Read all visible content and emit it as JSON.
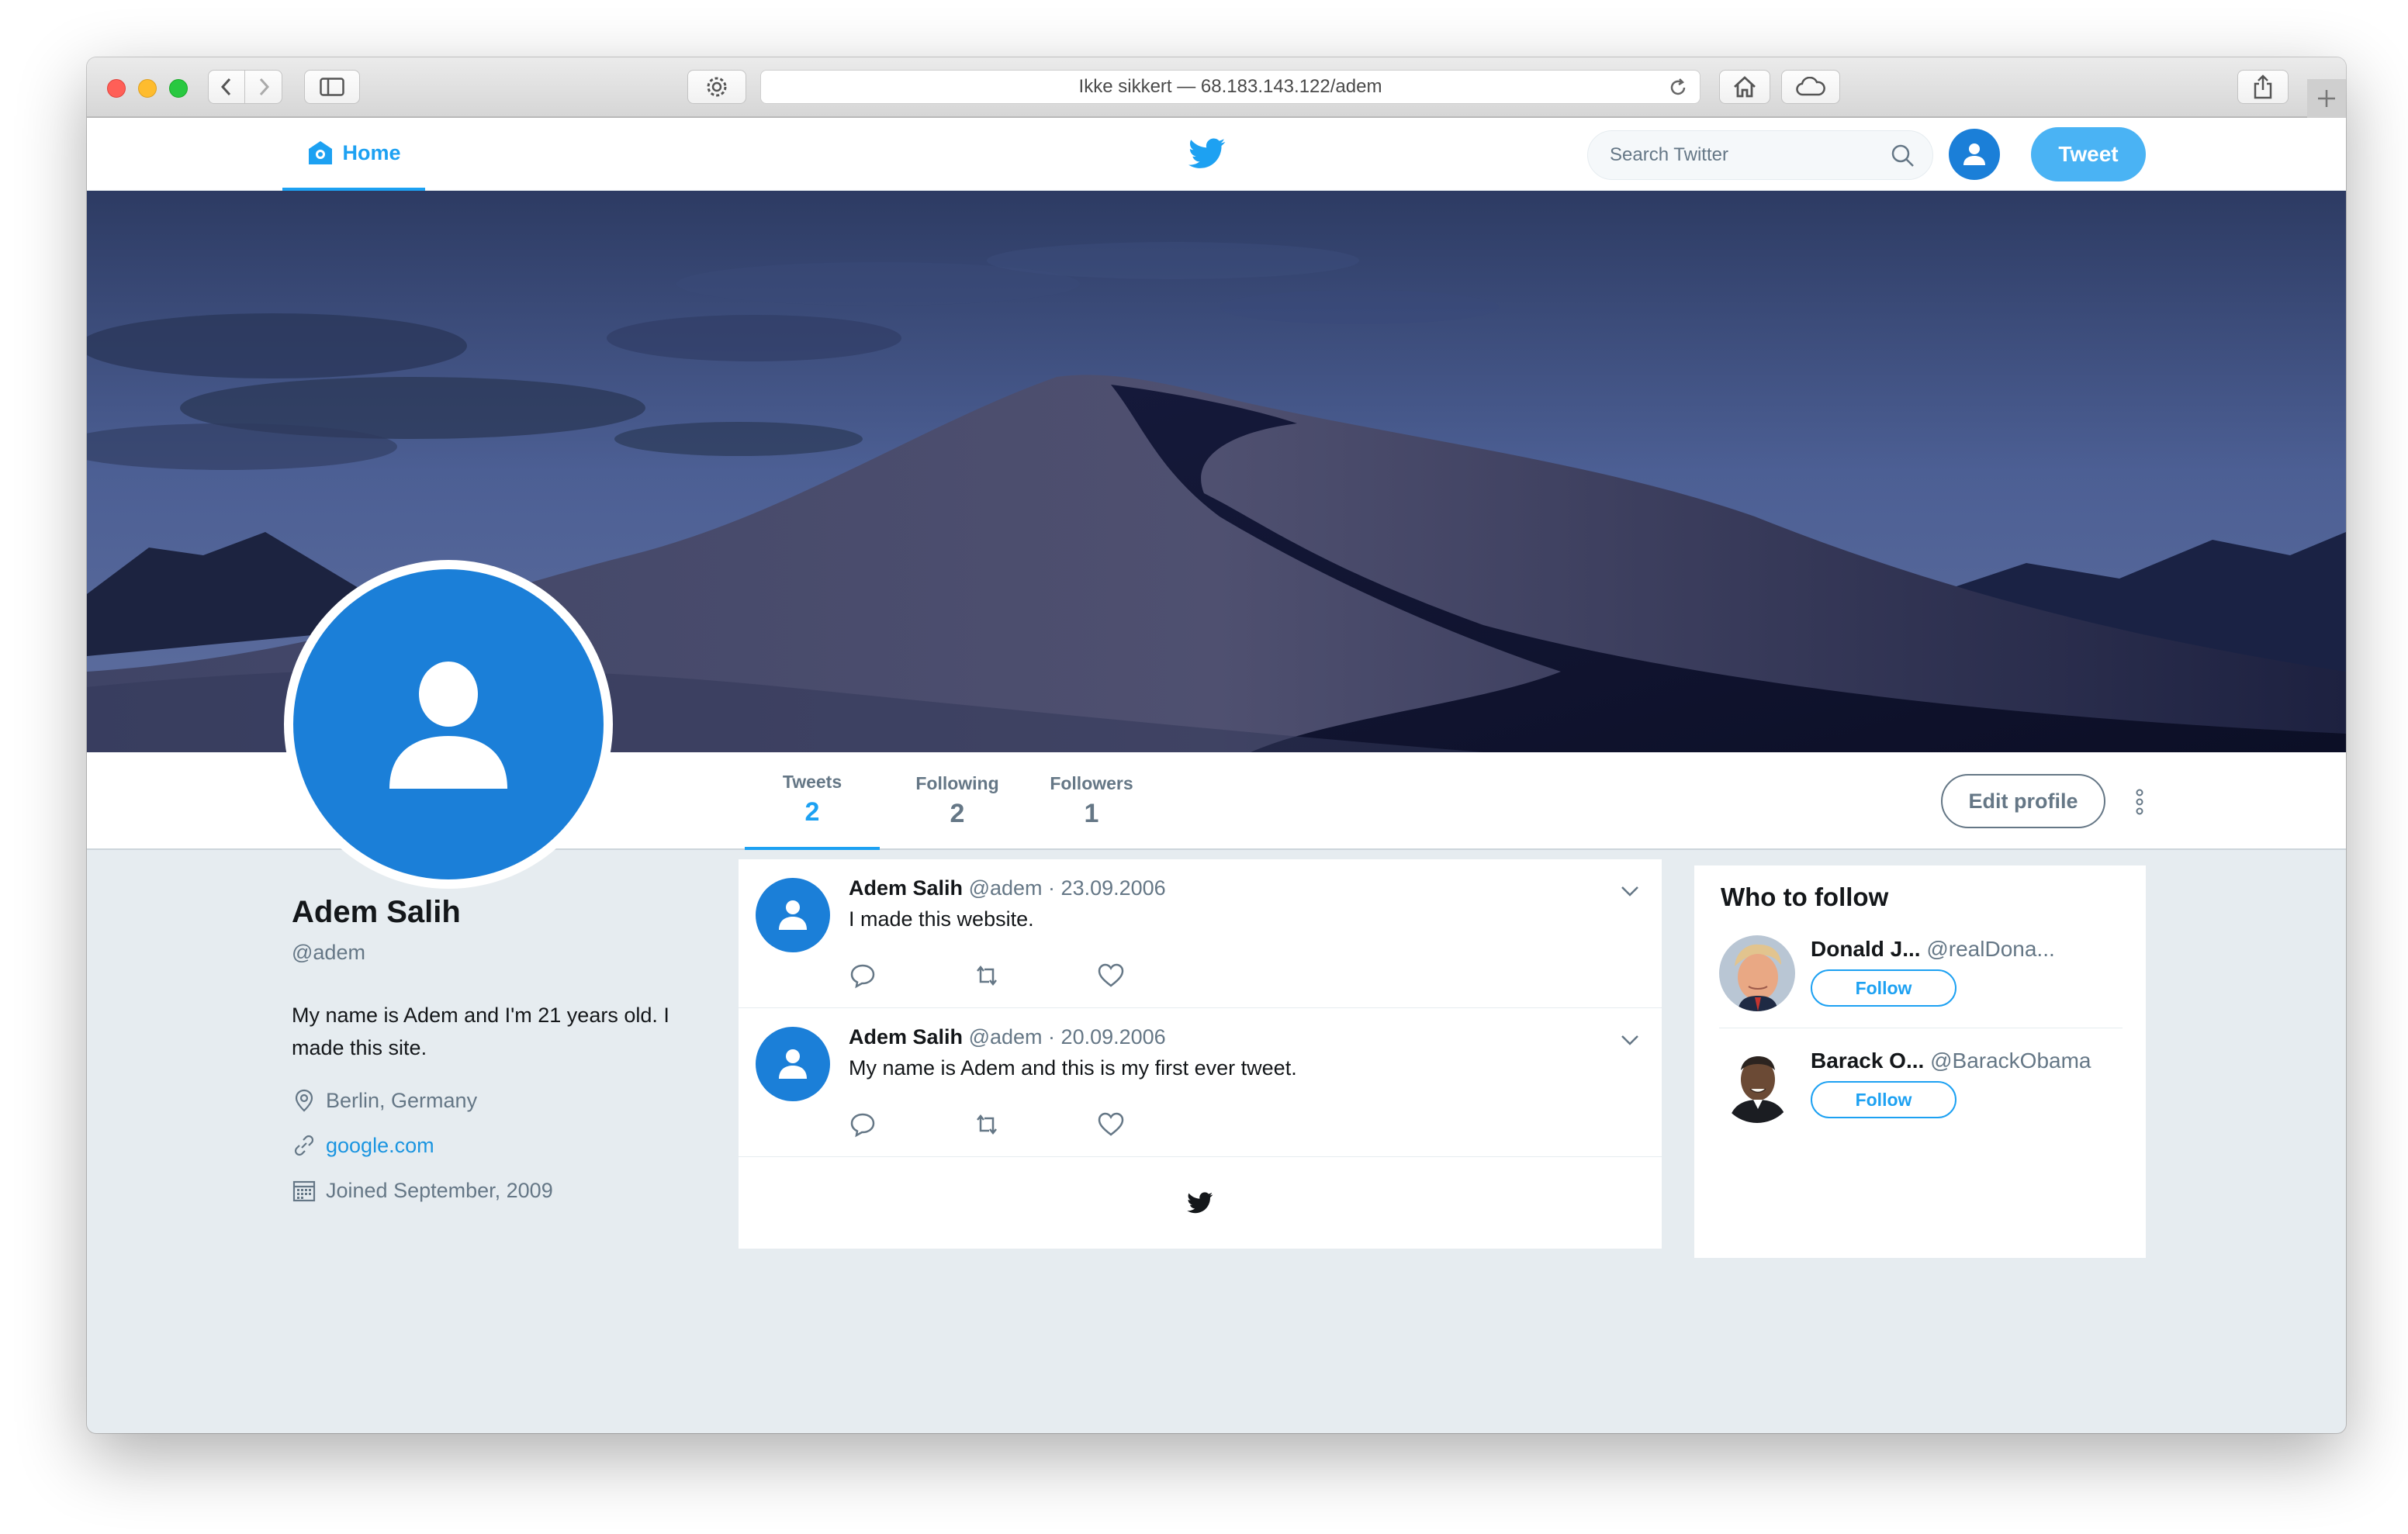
{
  "browser": {
    "address": "Ikke sikkert — 68.183.143.122/adem"
  },
  "topnav": {
    "home_label": "Home",
    "search_placeholder": "Search Twitter",
    "tweet_button": "Tweet"
  },
  "profile_nav": {
    "stats": [
      {
        "label": "Tweets",
        "value": "2"
      },
      {
        "label": "Following",
        "value": "2"
      },
      {
        "label": "Followers",
        "value": "1"
      }
    ],
    "edit_profile": "Edit profile"
  },
  "profile": {
    "name": "Adem Salih",
    "handle": "@adem",
    "bio": "My name is Adem and I'm 21 years old. I made this site.",
    "location": "Berlin, Germany",
    "website": "google.com",
    "joined": "Joined September, 2009"
  },
  "tweets": [
    {
      "author": "Adem Salih",
      "handle": "@adem",
      "separator": "·",
      "date": "23.09.2006",
      "text": "I made this website."
    },
    {
      "author": "Adem Salih",
      "handle": "@adem",
      "separator": "·",
      "date": "20.09.2006",
      "text": "My name is Adem and this is my first ever tweet."
    }
  ],
  "who_to_follow": {
    "title": "Who to follow",
    "users": [
      {
        "name": "Donald J...",
        "handle": "@realDona...",
        "button": "Follow"
      },
      {
        "name": "Barack O...",
        "handle": "@BarackObama",
        "button": "Follow"
      }
    ]
  },
  "colors": {
    "accent": "#1da1f2",
    "avatar_blue": "#1b7fd8",
    "background": "#e6ecf0"
  }
}
